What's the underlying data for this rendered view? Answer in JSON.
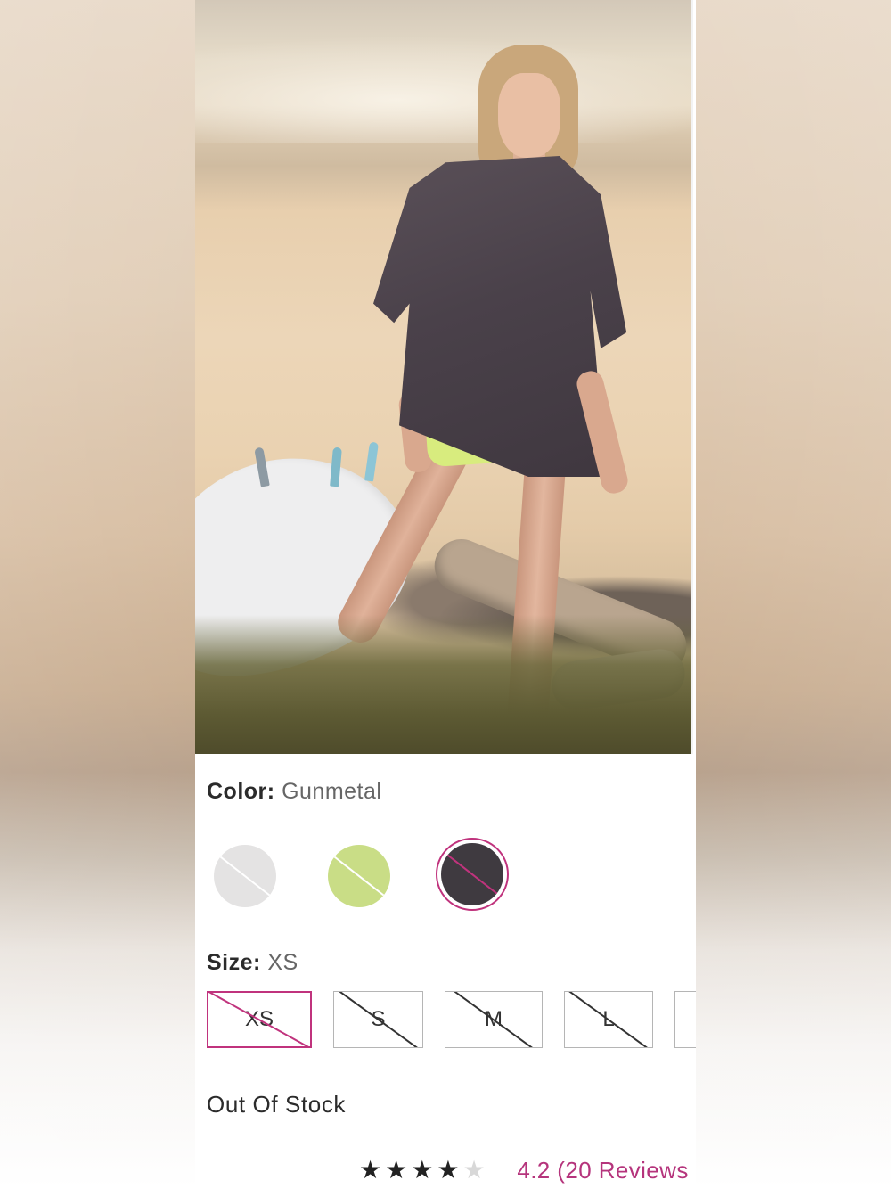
{
  "product": {
    "image_alt": "Model on beach wearing oversized tee",
    "color": {
      "label": "Color:",
      "value": "Gunmetal"
    },
    "color_swatches": [
      {
        "name": "white-swatch",
        "hex": "#e4e3e3",
        "available": false,
        "selected": false
      },
      {
        "name": "lime-swatch",
        "hex": "#c9dd86",
        "available": false,
        "selected": false
      },
      {
        "name": "gunmetal-swatch",
        "hex": "#3f3a40",
        "available": false,
        "selected": true
      }
    ],
    "size": {
      "label": "Size:",
      "value": "XS"
    },
    "sizes": [
      {
        "label": "XS",
        "available": false,
        "selected": true
      },
      {
        "label": "S",
        "available": false,
        "selected": false
      },
      {
        "label": "M",
        "available": false,
        "selected": false
      },
      {
        "label": "L",
        "available": false,
        "selected": false
      },
      {
        "label": "",
        "available": false,
        "selected": false
      }
    ],
    "stock_status": "Out Of Stock",
    "rating": {
      "stars_filled": 4,
      "stars_total": 5,
      "score_text": "4.2 (20 Reviews"
    }
  },
  "colors": {
    "accent": "#c0337d",
    "reviews_link": "#b5347c",
    "text_dark": "#2b2b2b",
    "text_muted": "#666666"
  }
}
